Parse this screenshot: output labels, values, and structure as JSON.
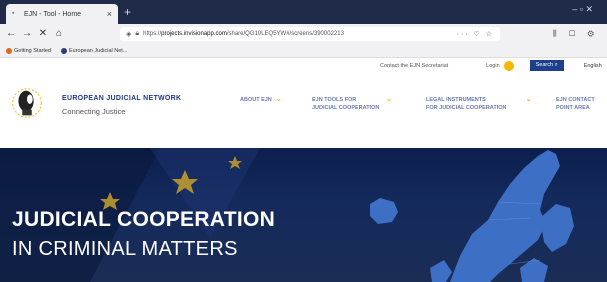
{
  "browser": {
    "tab_title": "EJN - Tool - Home",
    "tab_close": "×",
    "new_tab": "+",
    "window_controls": "– ▫ ✕",
    "url_prefix": "https://",
    "url_domain": "projects.invisionapp.com",
    "url_path": "/share/QG10LEQ5YW#/screens/390002213",
    "url_actions": "··· ♡ ☆",
    "toolbar_icons": "⫼ ▢ ⚙",
    "bookmarks": [
      {
        "label": "Getting Started",
        "color": "#e8641b"
      },
      {
        "label": "European Judicial Net...",
        "color": "#2a3f7a"
      }
    ]
  },
  "site": {
    "contact": "Contact the EJN Secretariat",
    "login": "Login",
    "search": "Search",
    "language": "English",
    "brand_name": "EUROPEAN JUDICIAL NETWORK",
    "brand_tagline": "Connecting Justice",
    "menu": [
      {
        "line1": "ABOUT EJN",
        "line2": ""
      },
      {
        "line1": "EJN TOOLS FOR",
        "line2": "JUDICIAL COOPERATION"
      },
      {
        "line1": "LEGAL INSTRUMENTS",
        "line2": "FOR JUDICIAL COOPERATION"
      },
      {
        "line1": "EJN CONTACT",
        "line2": "POINT AREA"
      }
    ]
  },
  "hero": {
    "title": "JUDICIAL COOPERATION",
    "subtitle": "IN CRIMINAL MATTERS"
  },
  "colors": {
    "brand_blue": "#1e3a8a",
    "accent_yellow": "#f0b400",
    "hero_bg": "#0c1f4d"
  }
}
